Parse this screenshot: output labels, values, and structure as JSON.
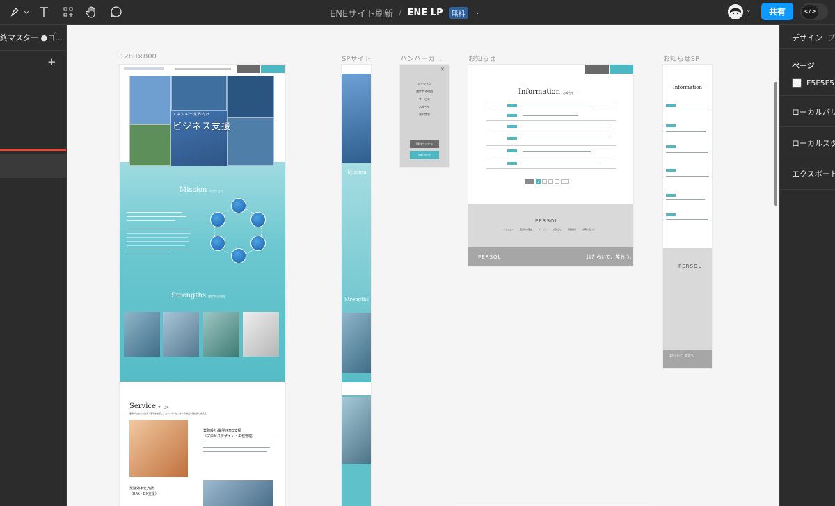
{
  "topbar": {
    "project": "ENEサイト刷新",
    "separator": "/",
    "file": "ENE LP",
    "plan_badge": "無料",
    "share_label": "共有",
    "dev_mode_label": "</>"
  },
  "left_panel": {
    "page_header": "終マスター ●コ..."
  },
  "frames": [
    {
      "label": "1280×800"
    },
    {
      "label": "SPサイト"
    },
    {
      "label": "ハンバーガ..."
    },
    {
      "label": "お知らせ"
    },
    {
      "label": "お知らせSP"
    }
  ],
  "lp": {
    "hero_title": "ビジネス支援",
    "hero_sub": "エネルギー業界向け",
    "mission": "Mission",
    "mission_jp": "ミッション",
    "strengths": "Strengths",
    "strengths_jp": "選ばれる理由",
    "service": "Service",
    "service_jp": "サービス",
    "service_desc": "業務プロセスの改善・変革を支援し、エネルギービジネスの成長を継続的に支える",
    "service_item1": "業務設計/開発/PMO支援",
    "service_item1_sub": "（プロセスデザイン・工程管理）",
    "service_item2": "業務効率化支援",
    "service_item2_sub": "（RPA・DX支援）"
  },
  "news": {
    "title": "Information",
    "title_jp": "お知らせ",
    "pager": [
      "1",
      "2",
      "3",
      "4",
      "次へ"
    ],
    "footer_brand": "PERSOL",
    "footer_slogan": "はたらいて、笑おう。",
    "footer_nav": [
      "ミッション",
      "選ばれる理由",
      "サービス",
      "お知らせ",
      "資料請求",
      "お問い合わせ"
    ]
  },
  "hamburger": {
    "menu": [
      "ミッション",
      "選ばれる理由",
      "サービス",
      "お知らせ",
      "資料請求"
    ],
    "btn_download": "資料ダウンロード",
    "btn_contact": "お問い合わせ"
  },
  "right_panel": {
    "tab_design": "デザイン",
    "tab_prototype": "プ",
    "page_label": "ページ",
    "page_color": "F5F5F5",
    "local_variables": "ローカルバリア",
    "local_styles": "ローカルスタイ",
    "export": "エクスポート"
  },
  "colors": {
    "accent": "#0d99ff",
    "canvas": "#F5F5F5",
    "teal": "#4bb8c4"
  }
}
